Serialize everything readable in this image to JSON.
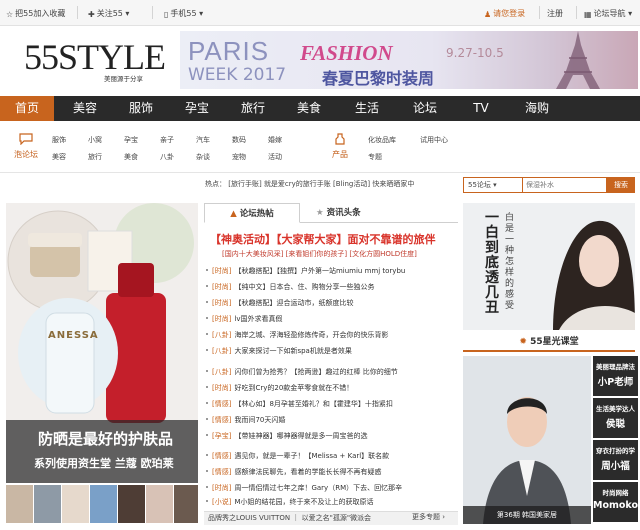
{
  "topbar": {
    "bookmark": "把55加入收藏",
    "follow": "关注55",
    "mobile": "手机55",
    "login": "请您登录",
    "register": "注册",
    "forum_nav": "论坛导航"
  },
  "logo": {
    "text": "55STYLE",
    "sub": "美丽源于分享"
  },
  "banner": {
    "paris": "PARIS",
    "fashion": "FASHION",
    "week": "WEEK 2017",
    "cn": "春夏巴黎时装周",
    "date": "9.27-10.5"
  },
  "nav": [
    "首页",
    "美容",
    "服饰",
    "孕宝",
    "旅行",
    "美食",
    "生活",
    "论坛",
    "TV",
    "海购"
  ],
  "subnav": {
    "forum": {
      "label": "泡论坛",
      "links": [
        [
          "服饰",
          "小窝",
          "孕宝",
          "亲子",
          "汽车",
          "数码",
          "婚嫁"
        ],
        [
          "美容",
          "旅行",
          "美食",
          "八卦",
          "杂谈",
          "宠物",
          "活动"
        ]
      ]
    },
    "product": {
      "label": "产品",
      "links": [
        [
          "化妆品库",
          "试用中心"
        ],
        [
          "专题"
        ]
      ]
    }
  },
  "hot": {
    "label": "热点：",
    "items": [
      "[旅行手账]",
      "就是爱cry的旅行手账",
      "[Bling活动]",
      "快来晒晒家中"
    ]
  },
  "search": {
    "select": "55论坛",
    "placeholder": "保湿补水",
    "button": "搜索"
  },
  "feature": {
    "caption1": "防晒是最好的护肤品",
    "caption2": "系列使用资生堂 兰蔻 欧珀莱",
    "brand": "ANESSA"
  },
  "tabs": {
    "tab1": "论坛热帖",
    "tab2": "资讯头条"
  },
  "headline": "【神奥活动】【大家帮大家】面对不靠谱的旅伴",
  "subheadline": "[国内十大美妆风采] [来看姐们你的孩子] [文化方圆HOLD住度]",
  "list": [
    {
      "cat": "[时尚]",
      "text": "【秋趣搭配】【独撰】户外第一站miumiu mmj torybu"
    },
    {
      "cat": "[时尚]",
      "text": "【纯中文】日本合、住、购物分享一些独公务"
    },
    {
      "cat": "[时尚]",
      "text": "【秋趣搭配】迎合运动市，纸额度比较"
    },
    {
      "cat": "[时尚]",
      "text": "lv国外求看真假"
    },
    {
      "cat": "[八卦]",
      "text": "海岸之城、浮海轻盈修炼传奇，开会你的快乐背影"
    },
    {
      "cat": "[八卦]",
      "text": "大家来探讨一下如新spa机就是者效果"
    },
    {
      "cat": "[八卦]",
      "text": "闪你们曾为抢秀？【抢两逊】趣过的红棒 比你的细节"
    },
    {
      "cat": "[时尚]",
      "text": "好吃到Cry的20款金苹零食就在不错！"
    },
    {
      "cat": "[情感]",
      "text": "【林心如】8月孕甚至婚礼？和【霍建华】十指紧扣"
    },
    {
      "cat": "[情感]",
      "text": "我而间70天闪婚"
    },
    {
      "cat": "[孕宝]",
      "text": "【带娃神器】哪神器得就是多一周宝爸的选"
    },
    {
      "cat": "[情感]",
      "text": "遇见你，就是一辈子！【Melissa + Karl】联名款"
    },
    {
      "cat": "[情感]",
      "text": "感额律法民聊先，看着的学能长长得不再有疑惑"
    },
    {
      "cat": "[时尚]",
      "text": "周一情侣情过七年之痒！Gary（RM）下去、回忆那辛"
    },
    {
      "cat": "[小说]",
      "text": "M小姐的结花园，终于来不及让上的获取原话"
    }
  ],
  "bottom_bar": {
    "text": "品牌秀之LOUIS VUITTON ｜ 以爱之名\"孤源\"微派会",
    "more": "更多专题"
  },
  "star": {
    "portrait_text": "白是一种怎样的感受",
    "portrait_big": "一白到底透几丑",
    "title": "55星光课堂",
    "caption": "第36期 韩国美家居",
    "tiles": [
      {
        "a": "美丽理品牌法",
        "b": "小P老师"
      },
      {
        "a": "生活美学达人",
        "b": "侯聪"
      },
      {
        "a": "穿衣打扮的学",
        "b": "周小福"
      },
      {
        "a": "时尚网络",
        "b": "Momoko"
      }
    ]
  },
  "colors": {
    "accent": "#c8641e",
    "nav_bg": "#2a2a2a",
    "headline": "#d9342b"
  }
}
